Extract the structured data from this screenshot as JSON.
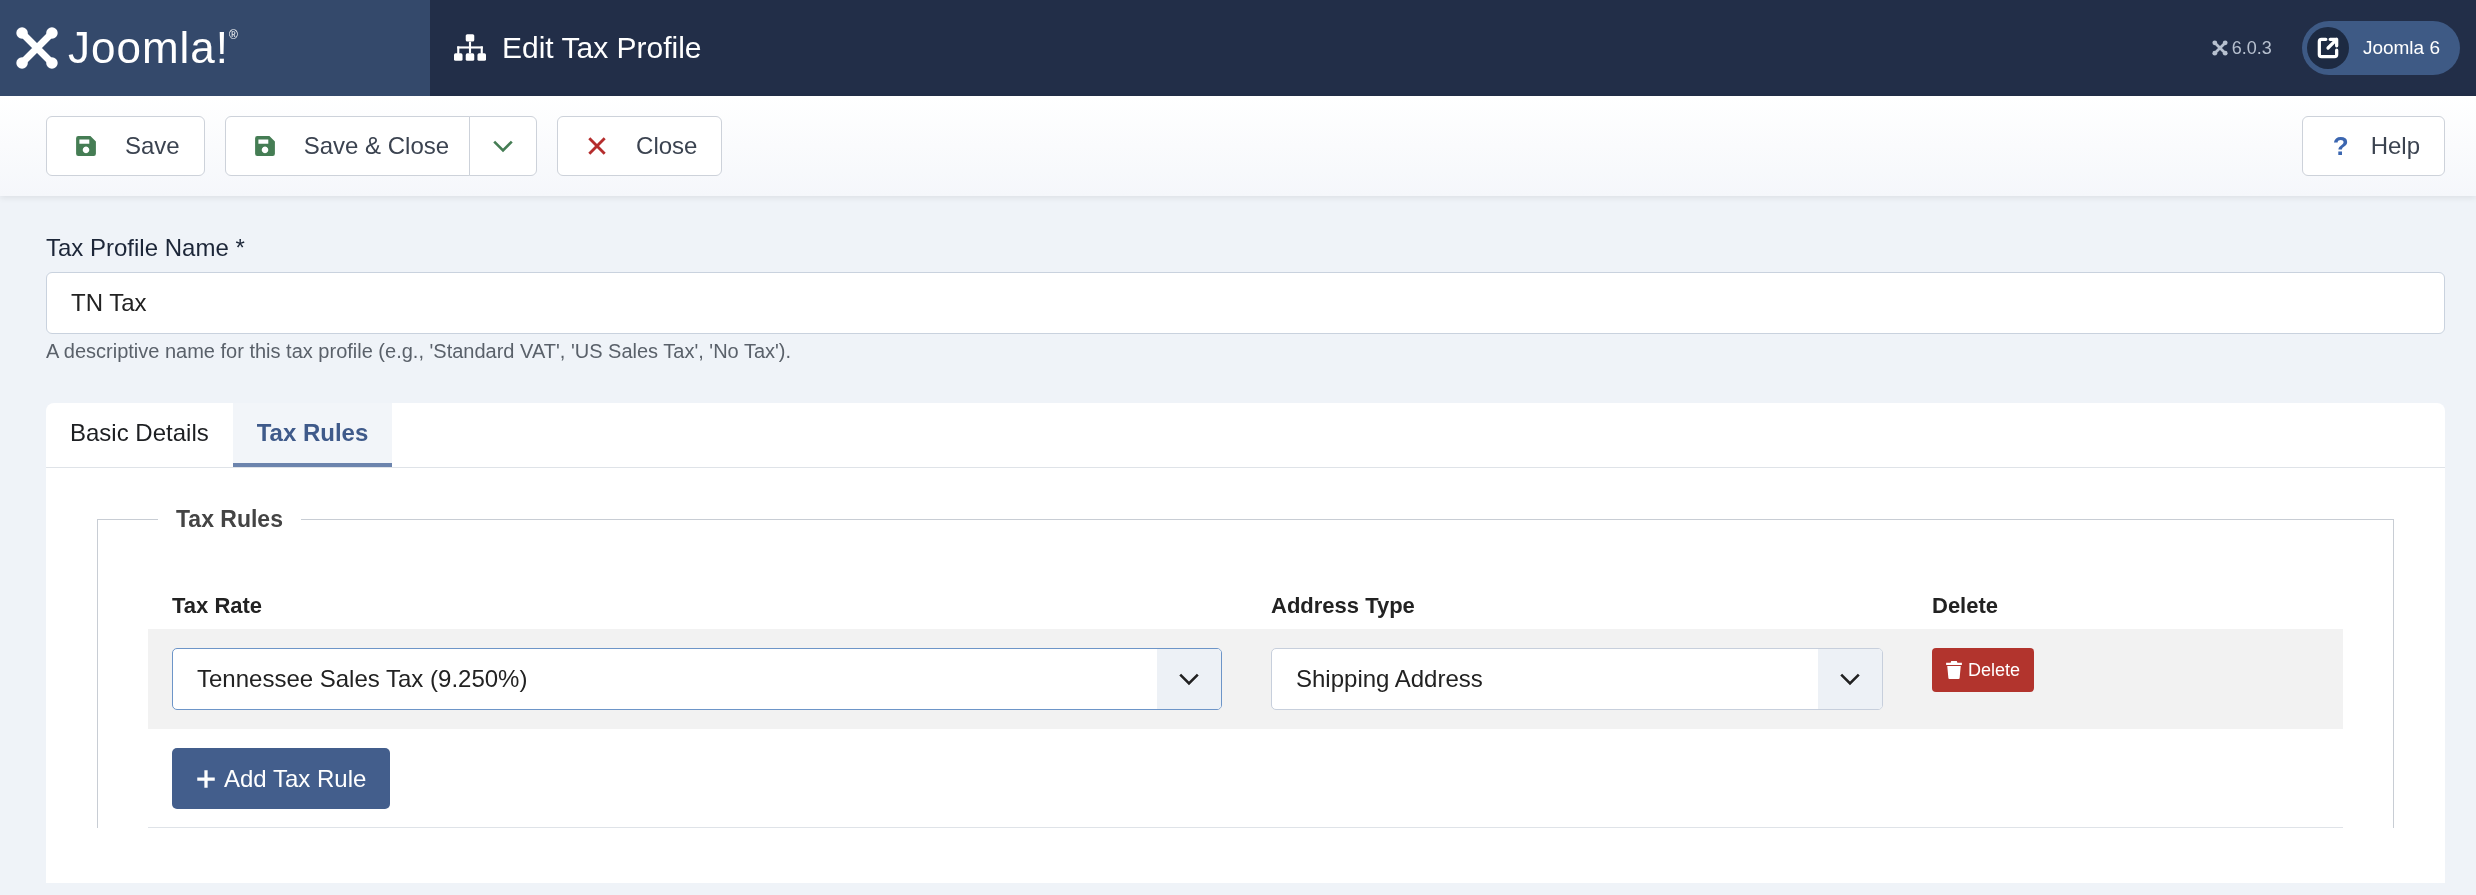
{
  "header": {
    "logo_text": "Joomla!$^{®}$",
    "title": "Edit Tax Profile",
    "version": "6.0.3",
    "site_button": "Joomla 6"
  },
  "toolbar": {
    "buttons": [
      {
        "label": "Save",
        "kind": "save"
      },
      {
        "label": "Save & Close",
        "kind": "save-split"
      },
      {
        "label": "Close",
        "kind": "close"
      }
    ],
    "help_icon": "?",
    "help": "Help"
  },
  "name_field": {
    "label": "Tax Profile Name *",
    "value": "TN Tax",
    "hint": "A descriptive name for this tax profile (e.g., 'Standard VAT', 'US Sales Tax', 'No Tax')."
  },
  "tabs": [
    {
      "label": "Basic Details",
      "selected": false
    },
    {
      "label": "Tax Rules",
      "selected": true
    }
  ],
  "fieldset": {
    "legend": "Tax Rules",
    "columns": [
      "Tax Rate",
      "Address Type",
      "Delete"
    ],
    "rows": [
      {
        "tax_rate": "Tennessee Sales Tax (9.250%)",
        "tax_rate_focused": true,
        "address_type": "Shipping Address",
        "delete": "Delete"
      }
    ],
    "add_button": "Add Tax Rule"
  }
}
